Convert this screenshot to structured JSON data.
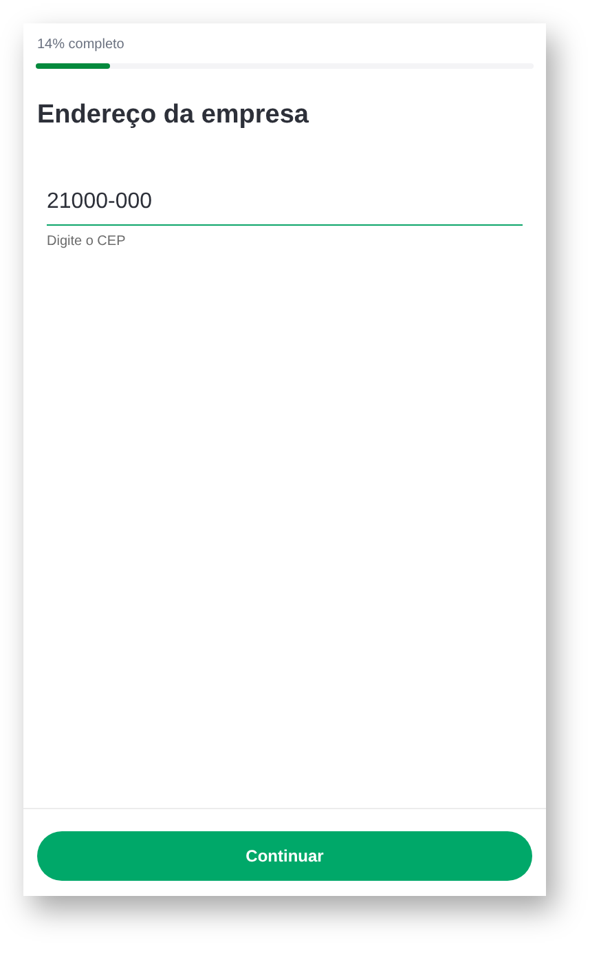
{
  "progress": {
    "label": "14% completo",
    "level": 0.15
  },
  "title": "Endereço da empresa",
  "cep_field": {
    "value": "21000-000",
    "helper": "Digite o CEP"
  },
  "button": "Continuar"
}
